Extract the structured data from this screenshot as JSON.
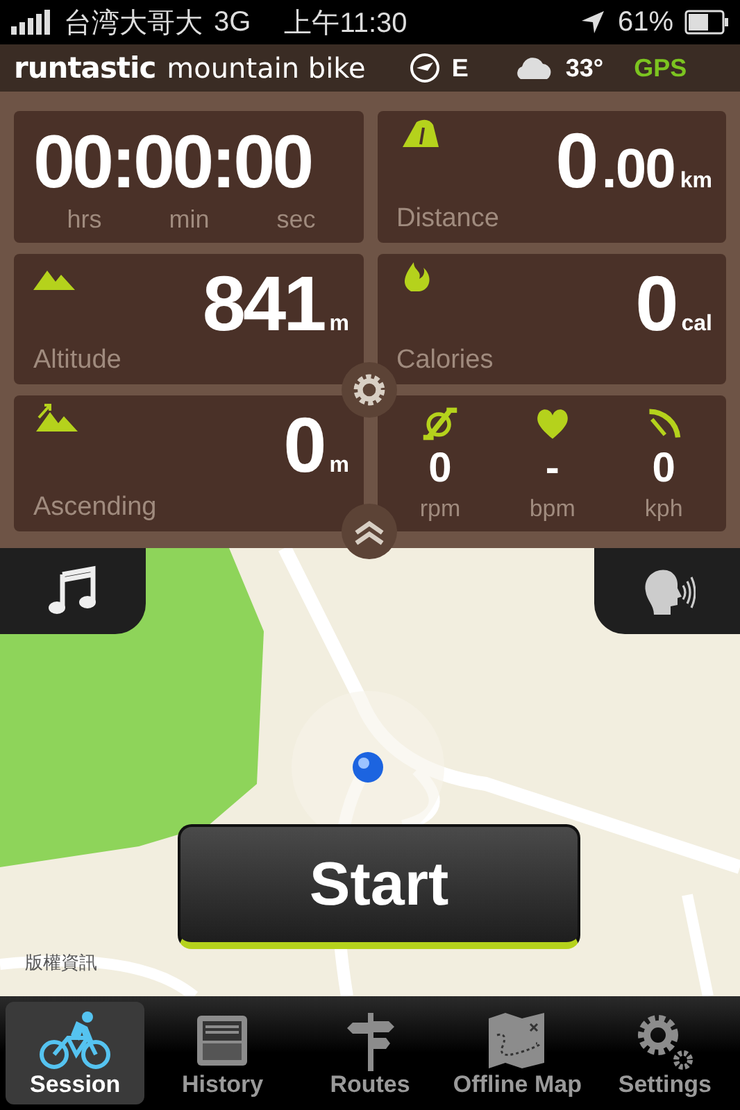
{
  "status_bar": {
    "carrier": "台湾大哥大",
    "network": "3G",
    "time": "上午11:30",
    "battery": "61%"
  },
  "header": {
    "brand": "runtastic",
    "product": "mountain bike",
    "heading": "E",
    "temperature": "33°",
    "gps": "GPS"
  },
  "timer": {
    "value": "00:00:00",
    "units": [
      "hrs",
      "min",
      "sec"
    ]
  },
  "distance": {
    "whole": "0",
    "fraction": ".00",
    "unit": "km",
    "label": "Distance"
  },
  "altitude": {
    "value": "841",
    "unit": "m",
    "label": "Altitude"
  },
  "calories": {
    "value": "0",
    "unit": "cal",
    "label": "Calories"
  },
  "ascending": {
    "value": "0",
    "unit": "m",
    "label": "Ascending"
  },
  "sensors": [
    {
      "kind": "cadence",
      "value": "0",
      "unit": "rpm"
    },
    {
      "kind": "heart",
      "value": "-",
      "unit": "bpm"
    },
    {
      "kind": "speed",
      "value": "0",
      "unit": "kph"
    }
  ],
  "map": {
    "kind": "picture",
    "copyright": "版權資訊"
  },
  "start_button": "Start",
  "tabs": [
    {
      "kind": "bike",
      "label": "Session",
      "selected": true
    },
    {
      "kind": "tray",
      "label": "History",
      "selected": false
    },
    {
      "kind": "signpost",
      "label": "Routes",
      "selected": false
    },
    {
      "kind": "map",
      "label": "Offline Map",
      "selected": false
    },
    {
      "kind": "gears",
      "label": "Settings",
      "selected": false
    }
  ]
}
